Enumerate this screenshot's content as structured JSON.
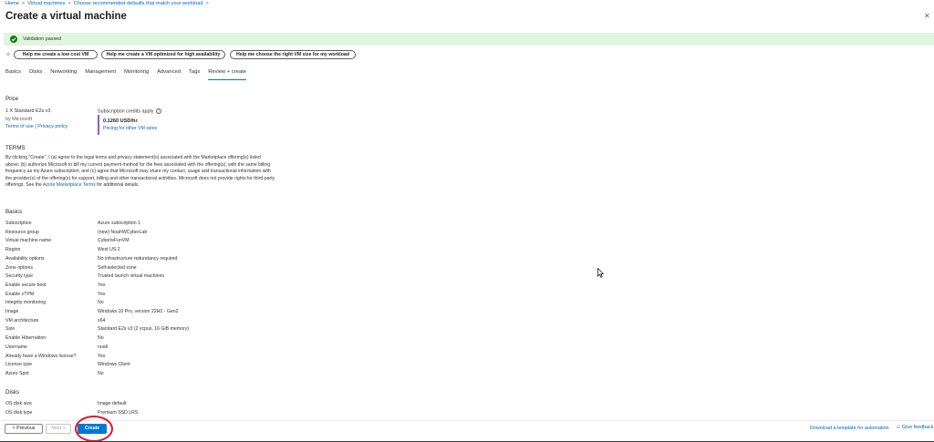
{
  "breadcrumb": [
    "Home",
    "Virtual machines",
    "Choose recommended defaults that match your workload"
  ],
  "page_title": "Create a virtual machine",
  "validation": {
    "text": "Validation passed",
    "color": "#107c10"
  },
  "help_buttons": [
    "Help me create a low cost VM",
    "Help me create a VM optimized for high availability",
    "Help me choose the right VM size for my workload"
  ],
  "tabs": [
    "Basics",
    "Disks",
    "Networking",
    "Management",
    "Monitoring",
    "Advanced",
    "Tags",
    "Review + create"
  ],
  "active_tab": "Review + create",
  "price": {
    "heading": "Price",
    "product": "1 X Standard E2s v3",
    "vendor": "by Microsoft",
    "terms_link": "Terms of use",
    "divider": "|",
    "privacy_link": "Privacy policy",
    "credits_label": "Subscription credits apply",
    "rate": "0.1260 USD/hr",
    "pricing_link": "Pricing for other VM sizes"
  },
  "terms": {
    "heading": "TERMS",
    "body": "By clicking \"Create\", I (a) agree to the legal terms and privacy statement(s) associated with the Marketplace offering(s) listed above; (b) authorize Microsoft to bill my current payment method for the fees associated with the offering(s), with the same billing frequency as my Azure subscription; and (c) agree that Microsoft may share my contact, usage and transactional information with the provider(s) of the offering(s) for support, billing and other transactional activities. Microsoft does not provide rights for third-party offerings. See the",
    "link": "Azure Marketplace Terms",
    "tail": "for additional details."
  },
  "basics": {
    "heading": "Basics",
    "rows": [
      {
        "k": "Subscription",
        "v": "Azure subscription 1"
      },
      {
        "k": "Resource group",
        "v": "(new) NoahWCyberLab"
      },
      {
        "k": "Virtual machine name",
        "v": "CyberIsFunVM"
      },
      {
        "k": "Region",
        "v": "West US 2"
      },
      {
        "k": "Availability options",
        "v": "No infrastructure redundancy required"
      },
      {
        "k": "Zone options",
        "v": "Self-selected zone"
      },
      {
        "k": "Security type",
        "v": "Trusted launch virtual machines"
      },
      {
        "k": "Enable secure boot",
        "v": "Yes"
      },
      {
        "k": "Enable vTPM",
        "v": "Yes"
      },
      {
        "k": "Integrity monitoring",
        "v": "No"
      },
      {
        "k": "Image",
        "v": "Windows 10 Pro, version 22H2 - Gen2"
      },
      {
        "k": "VM architecture",
        "v": "x64"
      },
      {
        "k": "Size",
        "v": "Standard E2s v3 (2 vcpus, 16 GiB memory)"
      },
      {
        "k": "Enable Hibernation",
        "v": "No"
      },
      {
        "k": "Username",
        "v": "noah"
      },
      {
        "k": "Already have a Windows license?",
        "v": "Yes"
      },
      {
        "k": "License type",
        "v": "Windows Client"
      },
      {
        "k": "Azure Spot",
        "v": "No"
      }
    ]
  },
  "disks": {
    "heading": "Disks",
    "rows": [
      {
        "k": "OS disk size",
        "v": "Image default"
      },
      {
        "k": "OS disk type",
        "v": "Premium SSD LRS"
      }
    ]
  },
  "footer": {
    "previous": "< Previous",
    "next": "Next >",
    "create": "Create",
    "download_link": "Download a template for automation",
    "feedback": "Give feedback"
  },
  "colors": {
    "accent": "#0078d4",
    "annotation": "#e81123",
    "validation_bg": "#dff6dd"
  }
}
